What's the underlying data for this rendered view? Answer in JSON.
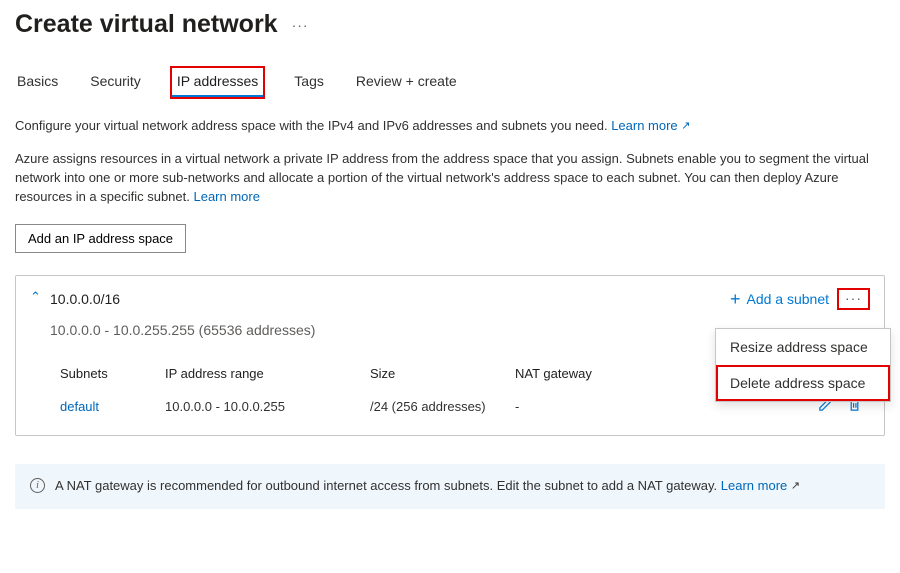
{
  "header": {
    "title": "Create virtual network",
    "moreActionsAria": "More actions"
  },
  "tabs": [
    {
      "label": "Basics",
      "active": false
    },
    {
      "label": "Security",
      "active": false
    },
    {
      "label": "IP addresses",
      "active": true,
      "highlighted": true
    },
    {
      "label": "Tags",
      "active": false
    },
    {
      "label": "Review + create",
      "active": false
    }
  ],
  "intro": {
    "line1": "Configure your virtual network address space with the IPv4 and IPv6 addresses and subnets you need. ",
    "learnMore1": "Learn more",
    "para2": "Azure assigns resources in a virtual network a private IP address from the address space that you assign. Subnets enable you to segment the virtual network into one or more sub-networks and allocate a portion of the virtual network's address space to each subnet. You can then deploy Azure resources in a specific subnet. ",
    "learnMore2": "Learn more"
  },
  "addButton": {
    "label": "Add an IP address space"
  },
  "addressSpace": {
    "cidr": "10.0.0.0/16",
    "rangeText": "10.0.0.0 - 10.0.255.255 (65536 addresses)",
    "addSubnetLabel": "Add a subnet",
    "columns": {
      "subnets": "Subnets",
      "range": "IP address range",
      "size": "Size",
      "nat": "NAT gateway"
    },
    "rows": [
      {
        "name": "default",
        "range": "10.0.0.0 - 10.0.0.255",
        "size": "/24 (256 addresses)",
        "nat": "-"
      }
    ]
  },
  "contextMenu": {
    "resize": "Resize address space",
    "delete": "Delete address space"
  },
  "banner": {
    "text": "A NAT gateway is recommended for outbound internet access from subnets. Edit the subnet to add a NAT gateway.  ",
    "learnMore": "Learn more"
  }
}
